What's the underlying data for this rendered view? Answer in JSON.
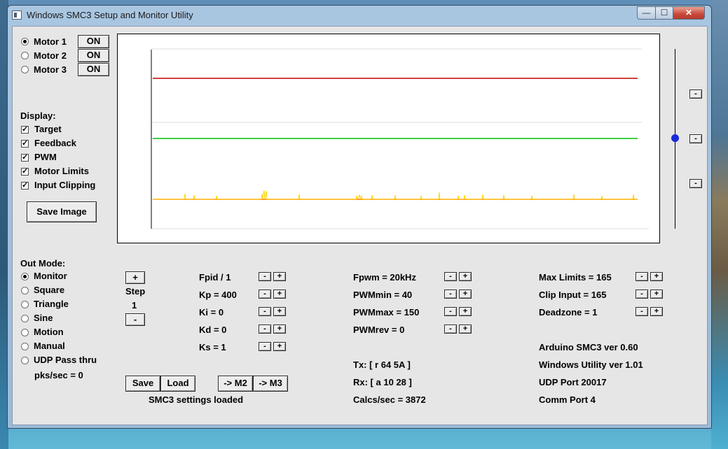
{
  "window": {
    "title": "Windows SMC3 Setup and Monitor Utility",
    "min_glyph": "—",
    "max_glyph": "☐",
    "close_glyph": "✕"
  },
  "motors": [
    {
      "label": "Motor 1",
      "button": "ON",
      "selected": true
    },
    {
      "label": "Motor 2",
      "button": "ON",
      "selected": false
    },
    {
      "label": "Motor 3",
      "button": "ON",
      "selected": false
    }
  ],
  "display": {
    "heading": "Display:",
    "items": [
      {
        "label": "Target",
        "checked": true
      },
      {
        "label": "Feedback",
        "checked": true
      },
      {
        "label": "PWM",
        "checked": true
      },
      {
        "label": "Motor Limits",
        "checked": true
      },
      {
        "label": "Input Clipping",
        "checked": true
      }
    ],
    "save_image": "Save Image",
    "check_glyph": "✓"
  },
  "out_mode": {
    "heading": "Out Mode:",
    "items": [
      {
        "label": "Monitor",
        "selected": true
      },
      {
        "label": "Square",
        "selected": false
      },
      {
        "label": "Triangle",
        "selected": false
      },
      {
        "label": "Sine",
        "selected": false
      },
      {
        "label": "Motion",
        "selected": false
      },
      {
        "label": "Manual",
        "selected": false
      },
      {
        "label": "UDP Pass thru",
        "selected": false
      }
    ],
    "pks": "pks/sec = 0"
  },
  "step": {
    "plus": "+",
    "label": "Step",
    "value": "1",
    "minus": "-"
  },
  "pid": [
    {
      "label": "Fpid / 1"
    },
    {
      "label": "Kp = 400"
    },
    {
      "label": "Ki = 0"
    },
    {
      "label": "Kd = 0"
    },
    {
      "label": "Ks = 1"
    }
  ],
  "pwm": [
    {
      "label": "Fpwm = 20kHz"
    },
    {
      "label": "PWMmin = 40"
    },
    {
      "label": "PWMmax = 150"
    },
    {
      "label": "PWMrev = 0"
    }
  ],
  "limits": [
    {
      "label": "Max Limits = 165"
    },
    {
      "label": "Clip Input = 165"
    },
    {
      "label": "Deadzone = 1"
    }
  ],
  "small_minus": "-",
  "small_plus": "+",
  "buttons": {
    "save": "Save",
    "load": "Load",
    "to_m2": "-> M2",
    "to_m3": "-> M3"
  },
  "status": {
    "settings": "SMC3 settings loaded",
    "tx": "Tx: [ r 64 5A ]",
    "rx": "Rx: [ a 10 28 ]",
    "calcs": "Calcs/sec = 3872"
  },
  "info": {
    "arduino": "Arduino SMC3 ver 0.60",
    "utility": "Windows Utility ver 1.01",
    "udp": "UDP Port 20017",
    "comm": "Comm Port 4"
  },
  "scale_buttons": [
    "-",
    "-",
    "-"
  ],
  "colors": {
    "target": "#c00000",
    "feedback": "#00c000",
    "pwm": "#ffd400",
    "limits": "#ff6a00",
    "slider_thumb": "#1a2bd8"
  }
}
